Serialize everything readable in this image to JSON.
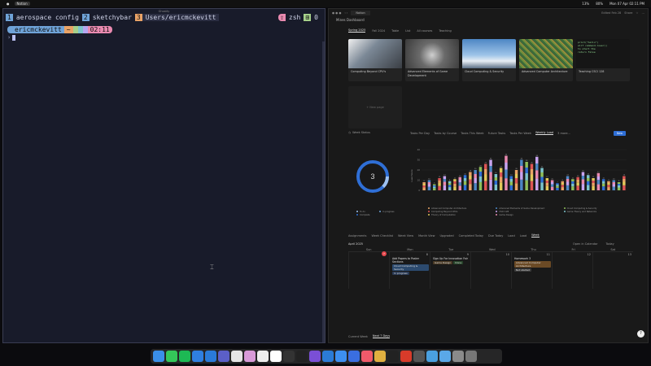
{
  "menubar": {
    "app": "Notion",
    "date_time": "Mon 07 Apr 02:11 PM",
    "battery": "80%",
    "cpu": "13%"
  },
  "terminal": {
    "title": "Ghostty",
    "tabs": [
      {
        "num": "1",
        "label": "aerospace config",
        "color": "#6fa3d8"
      },
      {
        "num": "2",
        "label": "sketchybar",
        "color": "#6fa3d8"
      },
      {
        "num": "3",
        "label": "Users/ericmckevitt",
        "color": "#e9a367"
      }
    ],
    "shell": "zsh",
    "shell_count": "0",
    "prompt": {
      "user": "ericmckevitt",
      "dir": "~",
      "time": "02:11"
    },
    "prompt_char": "›"
  },
  "notion": {
    "window_tab": "Notion",
    "title": "Mines Dashboard",
    "edited": "Edited Feb 28",
    "share": "Share",
    "view_tabs": [
      "Spring 2025",
      "Fall 2024",
      "Table",
      "List",
      "All courses",
      "Teaching"
    ],
    "courses": [
      {
        "title": "Computing Beyond CPU's",
        "color": "#5e6e7e"
      },
      {
        "title": "Advanced Elements of Game Development",
        "color": "#55575c"
      },
      {
        "title": "Cloud Computing & Security",
        "color": "#4d86c4"
      },
      {
        "title": "Advanced Computer Architecture",
        "color": "#3c6a3a"
      },
      {
        "title": "Teaching CSCI 128",
        "color": "#262626"
      }
    ],
    "new_page": "+ New page",
    "status_header": "Week Status",
    "status_value": "3",
    "status_legend": [
      "To do",
      "In progress",
      "Complete"
    ],
    "chart_tabs": [
      "Tasks Per Day",
      "Tasks by Course",
      "Tasks This Week",
      "Future Tasks",
      "Tasks Per Week",
      "Weekly Load",
      "3 more..."
    ],
    "new_button": "New",
    "chart_legend": [
      "Advanced Computer Architecture",
      "Computing Beyond CPUs",
      "Theory of Computation",
      "Advanced Elements of Game Development",
      "CSCI 128",
      "Machine Learning",
      "Game Design",
      "Cloud Computing & Security",
      "Game Theory and Networks"
    ],
    "bottom_tabs": [
      "Assignments",
      "Week Checklist",
      "Week View",
      "Month View",
      "Upgraded",
      "Completed Today",
      "Due Today",
      "Load",
      "Load",
      "Week"
    ],
    "calendar_month": "April 2025",
    "open_calendar": "Open in Calendar",
    "today_btn": "Today",
    "days": [
      "Sun",
      "Mon",
      "Tue",
      "Wed",
      "Thu",
      "Fri",
      "Sat"
    ],
    "day_nums": [
      "6",
      "7",
      "8",
      "9",
      "10",
      "11",
      "12",
      "13"
    ],
    "events": [
      {
        "title": "Add Papers to Poster Sections",
        "tag": "Cloud Computing & Security",
        "status": "In progress"
      },
      {
        "title": "Sign Up For Innovation Fair",
        "tag": "Game Design",
        "status": "Done"
      },
      {
        "title": "Homework 3",
        "tag": "Advanced Computer Architecture",
        "status": "Not started"
      }
    ],
    "footer_tabs": [
      "Current Week",
      "Next 7 Days"
    ]
  },
  "chart_data": {
    "type": "bar",
    "ylabel": "Load Score",
    "ylim": [
      0,
      40
    ],
    "yticks": [
      0,
      10,
      20,
      30,
      40
    ],
    "values": [
      8,
      10,
      6,
      12,
      14,
      9,
      11,
      13,
      15,
      18,
      20,
      23,
      26,
      30,
      16,
      22,
      34,
      14,
      20,
      30,
      28,
      26,
      33,
      22,
      12,
      10,
      7,
      9,
      14,
      11,
      13,
      18,
      15,
      12,
      17,
      11,
      9,
      10,
      8,
      14
    ]
  },
  "dock": {
    "apps": [
      "Finder",
      "Messages",
      "Spotify",
      "Safari",
      "Mail",
      "Teams",
      "Chrome",
      "Photos",
      "Typora",
      "Notion",
      "Alcove",
      "R",
      "Obsidian",
      "VS Code",
      "Xcode",
      "Preview",
      "Music",
      "TablePlus",
      "Terminal",
      "Office",
      "Sim",
      "Safari Tech",
      "Folder",
      "Downloads",
      "Trash"
    ]
  }
}
